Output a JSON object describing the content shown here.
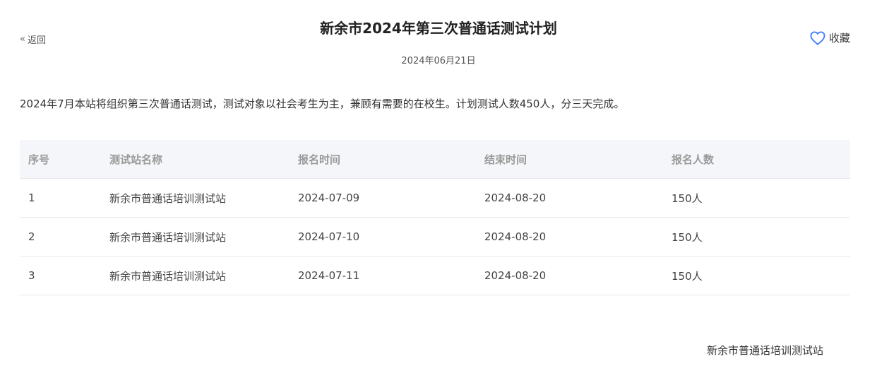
{
  "nav": {
    "back_icon": "double-chevron-left-icon",
    "back_label": "返回"
  },
  "article": {
    "title": "新余市2024年第三次普通话测试计划",
    "date": "2024年06月21日",
    "intro": "2024年7月本站将组织第三次普通话测试，测试对象以社会考生为主，兼顾有需要的在校生。计划测试人数450人，分三天完成。",
    "source": "新余市普通话培训测试站"
  },
  "favorite": {
    "icon": "heart-outline-icon",
    "label": "收藏",
    "icon_color": "#3a7afe"
  },
  "table": {
    "headers": [
      "序号",
      "测试站名称",
      "报名时间",
      "结束时间",
      "报名人数"
    ],
    "rows": [
      [
        "1",
        "新余市普通话培训测试站",
        "2024-07-09",
        "2024-08-20",
        "150人"
      ],
      [
        "2",
        "新余市普通话培训测试站",
        "2024-07-10",
        "2024-08-20",
        "150人"
      ],
      [
        "3",
        "新余市普通话培训测试站",
        "2024-07-11",
        "2024-08-20",
        "150人"
      ]
    ]
  }
}
